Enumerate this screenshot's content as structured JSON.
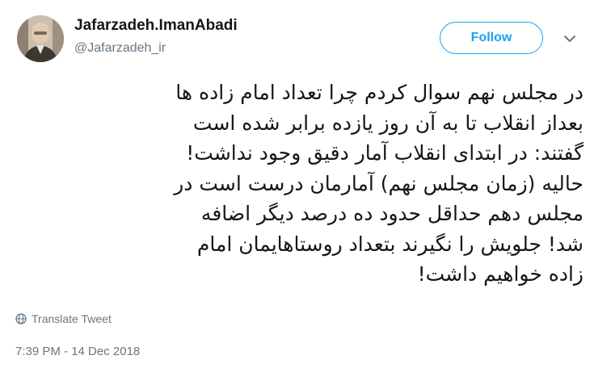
{
  "author": {
    "display_name": "Jafarzadeh.ImanAbadi",
    "handle": "@Jafarzadeh_ir"
  },
  "follow_button": {
    "label": "Follow"
  },
  "tweet": {
    "lines": [
      "در مجلس نهم سوال کردم چرا تعداد امام زاده ها",
      "بعداز انقلاب تا به آن روز یازده برابر شده است",
      "گفتند: در ابتدای انقلاب آمار دقیق وجود نداشت!",
      "حالیه (زمان مجلس نهم) آمارمان درست است در",
      "مجلس دهم حداقل حدود ده درصد دیگر اضافه",
      "شد! جلویش را نگیرند بتعداد روستاهایمان امام",
      "زاده خواهیم داشت!"
    ],
    "translate_label": "Translate Tweet",
    "timestamp": "7:39 PM - 14 Dec 2018"
  },
  "icons": {
    "avatar": "profile-photo",
    "chevron": "chevron-down-icon",
    "translate": "globe-icon"
  },
  "colors": {
    "accent": "#1da1f2",
    "text": "#14171a",
    "secondary": "#657786"
  }
}
